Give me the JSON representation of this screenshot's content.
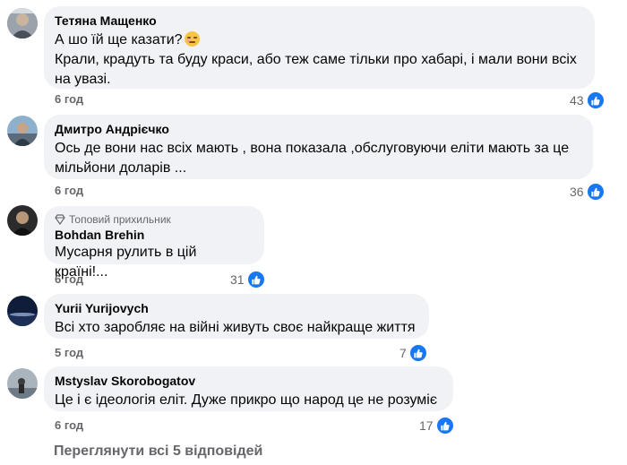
{
  "comments": [
    {
      "author": "Тетяна Мащенко",
      "lines": [
        "А шо їй ще казати?",
        "Крали, крадуть та буду краси, або теж саме тільки про хабарі, і мали вони всіх",
        "на увазі."
      ],
      "emoji": "pensive-face",
      "time": "6 год",
      "reactions": "43",
      "colors": {
        "avatar": "#8a8f94"
      }
    },
    {
      "author": "Дмитро Андрієчко",
      "lines": [
        "Ось де вони нас всіх мають , вона показала ,обслуговуючи еліти мають за це",
        "мільйони доларів ..."
      ],
      "time": "6 год",
      "reactions": "36",
      "colors": {
        "avatar": "#6b7c8f"
      }
    },
    {
      "badge": "Топовий прихильник",
      "author": "Bohdan Brehin",
      "lines": [
        "Мусарня рулить в цій країні!..."
      ],
      "time": "6 год",
      "reactions": "31",
      "colors": {
        "avatar": "#3a3a3a"
      }
    },
    {
      "author": "Yurii Yurijovych",
      "lines": [
        "Всі хто заробляє на війні живуть своє найкраще життя"
      ],
      "time": "5 год",
      "reactions": "7",
      "colors": {
        "avatar": "#1c2a4a"
      }
    },
    {
      "author": "Mstyslav Skorobogatov",
      "lines": [
        "Це і є ідеологія еліт. Дуже прикро що народ це не розуміє"
      ],
      "time": "6 год",
      "reactions": "17",
      "colors": {
        "avatar": "#7d8a96"
      }
    }
  ],
  "view_more": "Переглянути всі 5 відповідей",
  "colors": {
    "bubble": "#f0f2f5",
    "like": "#1877f2",
    "meta": "#65676b"
  }
}
